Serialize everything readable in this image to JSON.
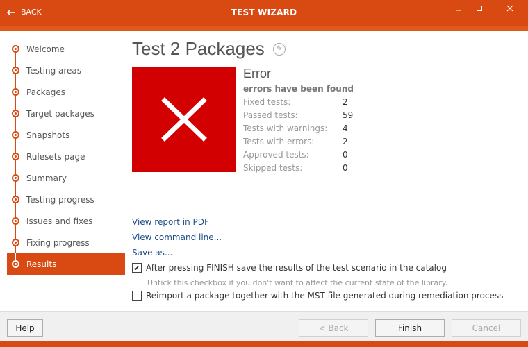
{
  "window": {
    "title": "TEST WIZARD",
    "back_label": "BACK",
    "controls": [
      "minimize",
      "maximize",
      "close"
    ]
  },
  "sidebar": {
    "steps": [
      {
        "label": "Welcome"
      },
      {
        "label": "Testing areas"
      },
      {
        "label": "Packages"
      },
      {
        "label": "Target packages"
      },
      {
        "label": "Snapshots"
      },
      {
        "label": "Rulesets page"
      },
      {
        "label": "Summary"
      },
      {
        "label": "Testing progress"
      },
      {
        "label": "Issues and fixes"
      },
      {
        "label": "Fixing progress"
      },
      {
        "label": "Results",
        "active": true
      }
    ]
  },
  "main": {
    "title": "Test 2 Packages",
    "status": "Error",
    "status_subtitle": "errors have been found",
    "status_color": "#d20000",
    "stats": [
      {
        "label": "Fixed tests:",
        "value": "2"
      },
      {
        "label": "Passed tests:",
        "value": "59"
      },
      {
        "label": "Tests with warnings:",
        "value": "4"
      },
      {
        "label": "Tests with errors:",
        "value": "2"
      },
      {
        "label": "Approved tests:",
        "value": "0"
      },
      {
        "label": "Skipped tests:",
        "value": "0"
      }
    ],
    "links": {
      "pdf": "View report in PDF",
      "cmd": "View command line...",
      "save": "Save as..."
    },
    "save_results": {
      "label": "After pressing FINISH save the results of the test scenario in the catalog",
      "checked": true,
      "hint": "Untick this checkbox if you don't want to affect the current state of the library."
    },
    "reimport": {
      "label": "Reimport a package together with the MST file generated during remediation process",
      "checked": false
    }
  },
  "footer": {
    "help": "Help",
    "back": "< Back",
    "finish": "Finish",
    "cancel": "Cancel"
  },
  "theme": {
    "accent": "#d84a12"
  }
}
